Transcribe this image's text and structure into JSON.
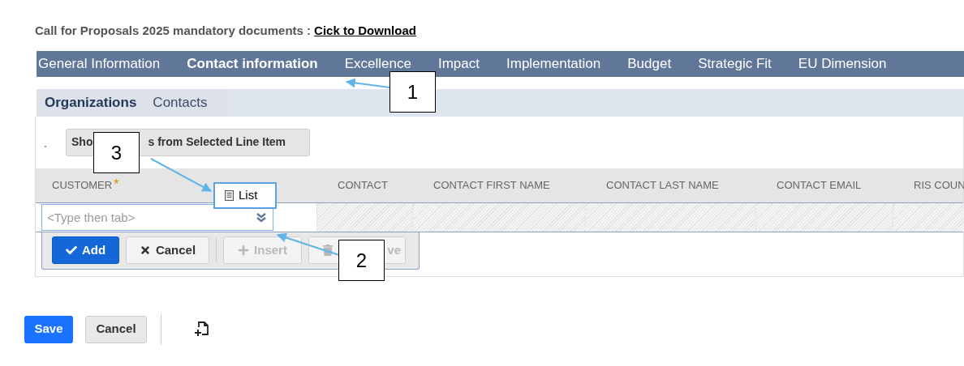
{
  "header": {
    "label": "Call for Proposals 2025 mandatory documents :",
    "link": "Cick to Download"
  },
  "main_tabs": [
    {
      "label": "General Information",
      "selected": false
    },
    {
      "label": "Contact information",
      "selected": true
    },
    {
      "label": "Excellence",
      "selected": false
    },
    {
      "label": "Impact",
      "selected": false
    },
    {
      "label": "Implementation",
      "selected": false
    },
    {
      "label": "Budget",
      "selected": false
    },
    {
      "label": "Strategic Fit",
      "selected": false
    },
    {
      "label": "EU Dimension",
      "selected": false
    }
  ],
  "sub_tabs": [
    {
      "label": "Organizations",
      "selected": true
    },
    {
      "label": "Contacts",
      "selected": false
    }
  ],
  "show_button": {
    "text_before": "Sho",
    "text_after": "s from Selected Line Item"
  },
  "table": {
    "columns": [
      {
        "label": "CUSTOMER",
        "required_mark": "*"
      },
      {
        "label": "CONTACT"
      },
      {
        "label": "CONTACT FIRST NAME"
      },
      {
        "label": "CONTACT LAST NAME"
      },
      {
        "label": "CONTACT EMAIL"
      },
      {
        "label": "RIS COUN"
      }
    ],
    "edit_row": {
      "placeholder": "<Type then tab>"
    },
    "actions": [
      {
        "kind": "primary",
        "label": "Add",
        "disabled": false
      },
      {
        "kind": "cancel",
        "label": "Cancel",
        "disabled": false
      },
      {
        "kind": "insert",
        "label": "Insert",
        "disabled": true
      },
      {
        "kind": "remove",
        "label": "ve",
        "disabled": true
      }
    ]
  },
  "tooltip": {
    "label": "List"
  },
  "callouts": [
    {
      "label": "1"
    },
    {
      "label": "2"
    },
    {
      "label": "3"
    }
  ],
  "footer": {
    "save": "Save",
    "cancel": "Cancel"
  }
}
